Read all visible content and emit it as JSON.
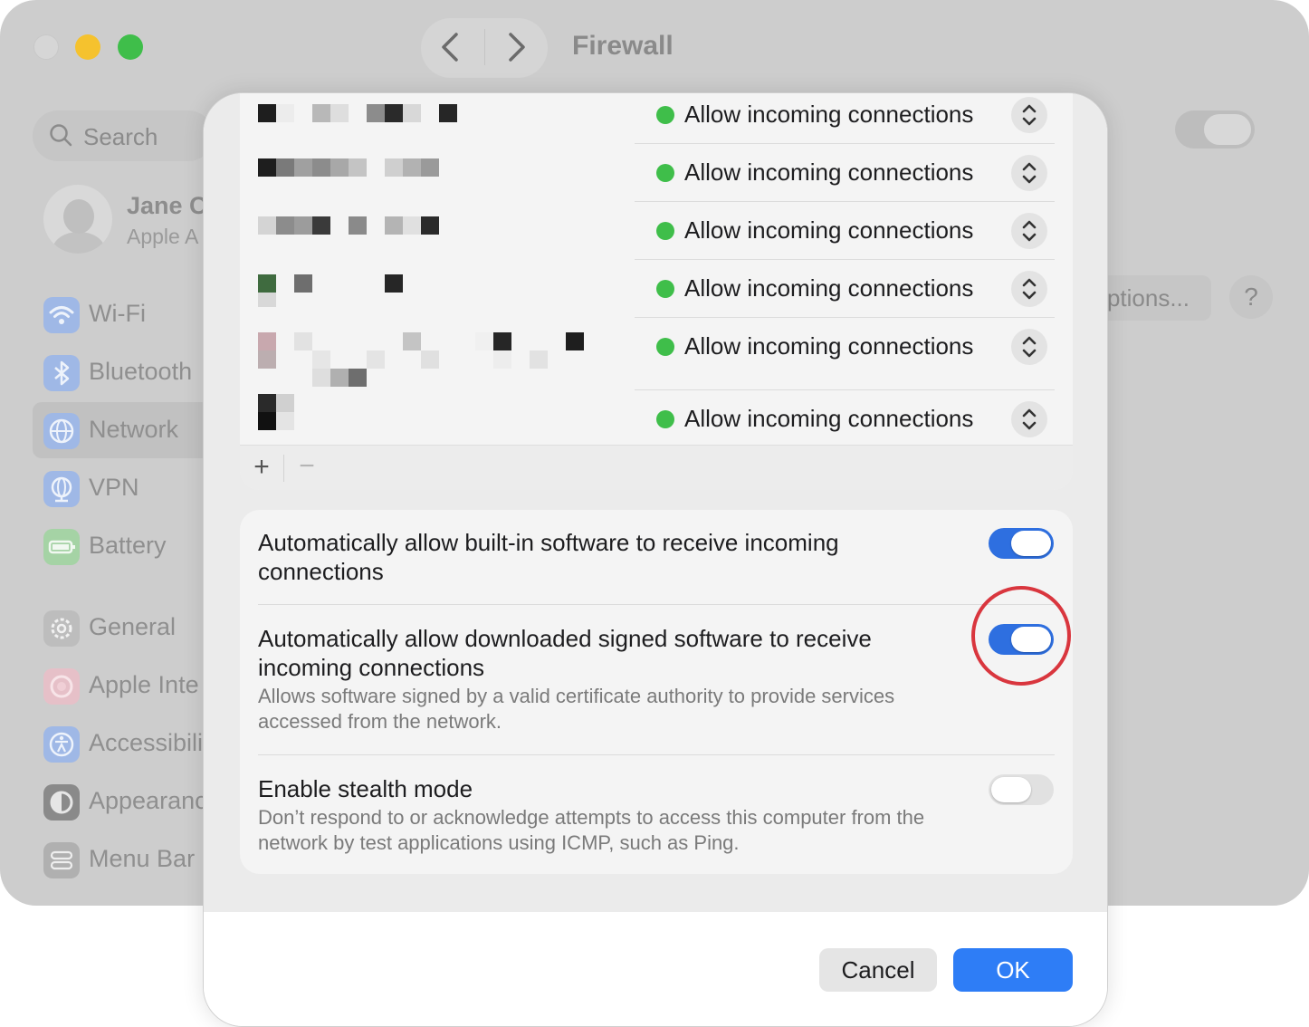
{
  "window": {
    "title": "Firewall",
    "back_icon": "chevron-left-icon",
    "forward_icon": "chevron-right-icon"
  },
  "sidebar": {
    "search_placeholder": "Search",
    "user": {
      "name": "Jane C",
      "subtitle": "Apple A"
    },
    "items": [
      {
        "label": "Wi-Fi",
        "icon": "wifi-icon",
        "color": "#9fb8e6"
      },
      {
        "label": "Bluetooth",
        "icon": "bluetooth-icon",
        "color": "#9fb8e6"
      },
      {
        "label": "Network",
        "icon": "globe-icon",
        "color": "#9fb8e6",
        "selected": true
      },
      {
        "label": "VPN",
        "icon": "vpn-globe-icon",
        "color": "#9fb8e6"
      },
      {
        "label": "Battery",
        "icon": "battery-icon",
        "color": "#a5d3a5"
      },
      {
        "label": "General",
        "icon": "gear-icon",
        "color": "#bdbdbd"
      },
      {
        "label": "Apple Inte",
        "icon": "apple-intelligence-icon",
        "color": "#e6c0c8"
      },
      {
        "label": "Accessibili",
        "icon": "accessibility-icon",
        "color": "#9fb8e6"
      },
      {
        "label": "Appearanc",
        "icon": "appearance-icon",
        "color": "#8a8a8a"
      },
      {
        "label": "Menu Bar",
        "icon": "menu-bar-icon",
        "color": "#b0b0b0"
      }
    ]
  },
  "background": {
    "options_label": "Options...",
    "help_label": "?"
  },
  "app_list": {
    "rows": [
      {
        "status": "Allow incoming connections"
      },
      {
        "status": "Allow incoming connections"
      },
      {
        "status": "Allow incoming connections"
      },
      {
        "status": "Allow incoming connections"
      },
      {
        "status": "Allow incoming connections"
      },
      {
        "status": "Allow incoming connections"
      }
    ],
    "status_color": "#3fbe4a",
    "add_label": "+",
    "remove_label": "−"
  },
  "settings": {
    "builtin": {
      "title": "Automatically allow built-in software to receive incoming connections",
      "enabled": true
    },
    "signed": {
      "title": "Automatically allow downloaded signed software to receive incoming connections",
      "description": "Allows software signed by a valid certificate authority to provide services accessed from the network.",
      "enabled": true
    },
    "stealth": {
      "title": "Enable stealth mode",
      "description": "Don’t respond to or acknowledge attempts to access this computer from the network by test applications using ICMP, such as Ping.",
      "enabled": false
    },
    "accent_color": "#2e6fe0",
    "highlight_color": "#d9363e"
  },
  "buttons": {
    "cancel": "Cancel",
    "ok": "OK"
  }
}
